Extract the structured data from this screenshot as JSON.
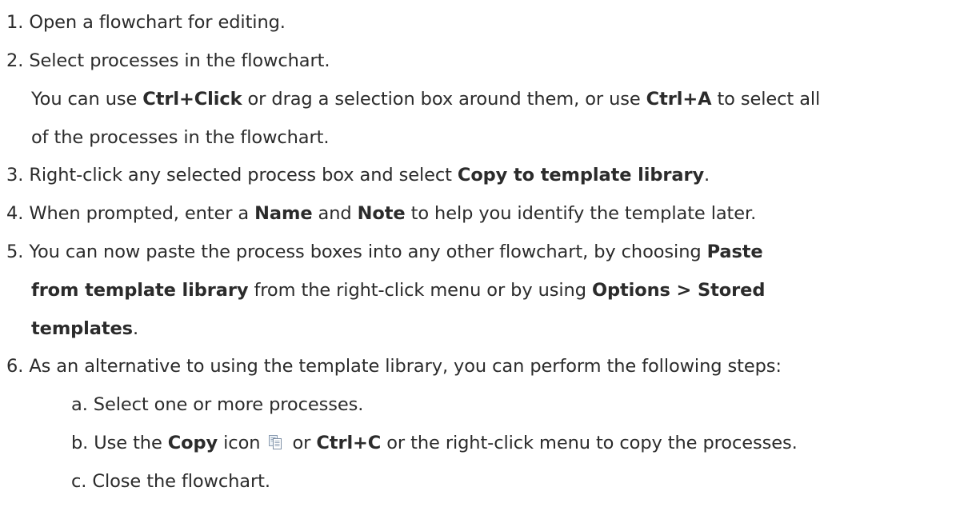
{
  "steps": {
    "s1": {
      "num": "1.",
      "text": " Open a flowchart for editing."
    },
    "s2": {
      "num": "2.",
      "text": " Select processes in the flowchart."
    },
    "s2_detail": {
      "t1": "You can use ",
      "k1": "Ctrl+Click",
      "t2": " or drag a selection box around them, or use ",
      "k2": "Ctrl+A",
      "t3": " to select all",
      "t4": "of the processes in the flowchart."
    },
    "s3": {
      "num": "3.",
      "t1": " Right-click any selected process box and select ",
      "k1": "Copy to template library",
      "t2": "."
    },
    "s4": {
      "num": "4.",
      "t1": " When prompted, enter a ",
      "k1": "Name",
      "t2": " and ",
      "k2": "Note",
      "t3": " to help you identify the template later."
    },
    "s5": {
      "num": "5.",
      "t1": " You can now paste the process boxes into any other flowchart, by choosing ",
      "k1": "Paste",
      "k2": "from template library",
      "t2": " from the right-click menu or by using ",
      "k3": "Options > Stored",
      "k4": "templates",
      "t3": "."
    },
    "s6": {
      "num": "6.",
      "text": " As an alternative to using the template library, you can perform the following steps:"
    },
    "sa": {
      "num": "a.",
      "text": " Select one or more processes."
    },
    "sb": {
      "num": "b.",
      "t1": " Use the ",
      "k1": "Copy",
      "t2": " icon ",
      "t3": " or ",
      "k2": "Ctrl+C",
      "t4": " or the right-click menu to copy the processes."
    },
    "sc": {
      "num": "c.",
      "text": " Close the flowchart."
    }
  },
  "icons": {
    "copy": "copy-icon"
  }
}
